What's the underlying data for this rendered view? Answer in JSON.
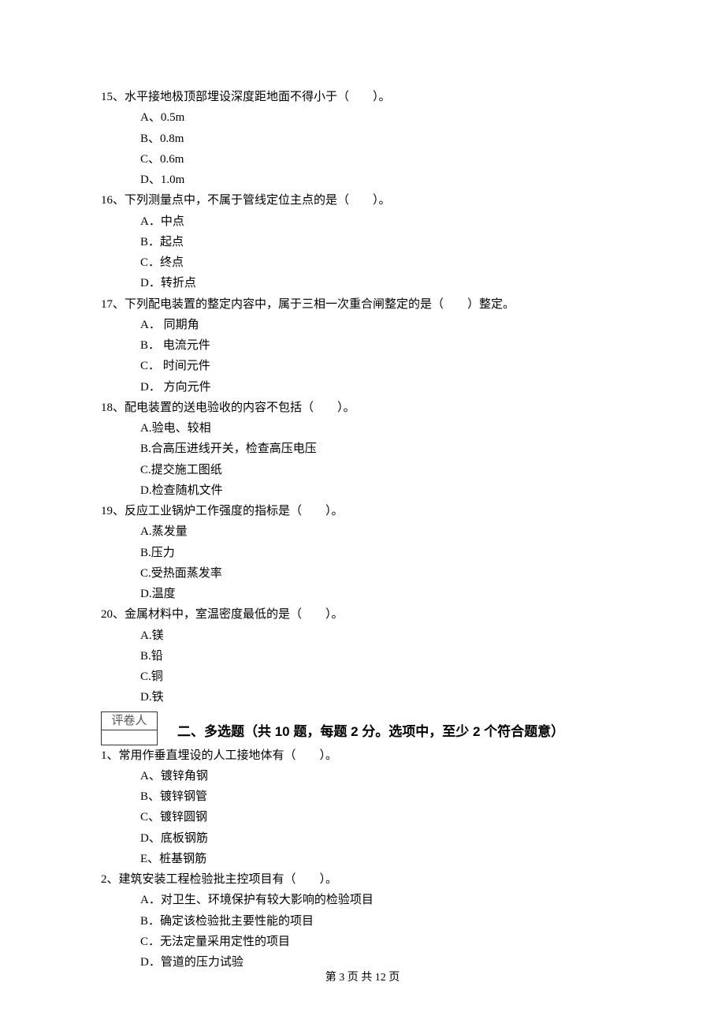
{
  "questions": [
    {
      "num": "15、",
      "stem": "水平接地极顶部埋设深度距地面不得小于（　　）。",
      "opts": [
        "A、0.5m",
        "B、0.8m",
        "C、0.6m",
        "D、1.0m"
      ]
    },
    {
      "num": "16、",
      "stem": "下列测量点中，不属于管线定位主点的是（　　）。",
      "opts": [
        "A．中点",
        "B．起点",
        "C．终点",
        "D．转折点"
      ]
    },
    {
      "num": "17、",
      "stem": "下列配电装置的整定内容中，属于三相一次重合闸整定的是（　　）整定。",
      "opts": [
        "A． 同期角",
        "B． 电流元件",
        "C． 时间元件",
        "D． 方向元件"
      ]
    },
    {
      "num": "18、",
      "stem": "配电装置的送电验收的内容不包括（　　）。",
      "opts": [
        "A.验电、较相",
        "B.合高压进线开关，检查高压电压",
        "C.提交施工图纸",
        "D.检查随机文件"
      ]
    },
    {
      "num": "19、",
      "stem": "反应工业锅炉工作强度的指标是（　　）。",
      "opts": [
        "A.蒸发量",
        "B.压力",
        "C.受热面蒸发率",
        "D.温度"
      ]
    },
    {
      "num": "20、",
      "stem": "金属材料中，室温密度最低的是（　　）。",
      "opts": [
        "A.镁",
        "B.铅",
        "C.铜",
        "D.铁"
      ]
    }
  ],
  "grader_label": "评卷人",
  "section_title": "二、多选题（共 10 题，每题 2 分。选项中，至少 2 个符合题意）",
  "questions2": [
    {
      "num": "1、",
      "stem": "常用作垂直埋设的人工接地体有（　　）。",
      "opts": [
        "A、镀锌角钢",
        "B、镀锌钢管",
        "C、镀锌圆钢",
        "D、底板钢筋",
        "E、桩基钢筋"
      ]
    },
    {
      "num": "2、",
      "stem": "建筑安装工程检验批主控项目有（　　）。",
      "opts": [
        "A．对卫生、环境保护有较大影响的检验项目",
        "B．确定该检验批主要性能的项目",
        "C．无法定量采用定性的项目",
        "D．管道的压力试验"
      ]
    }
  ],
  "footer": "第 3 页 共 12 页"
}
